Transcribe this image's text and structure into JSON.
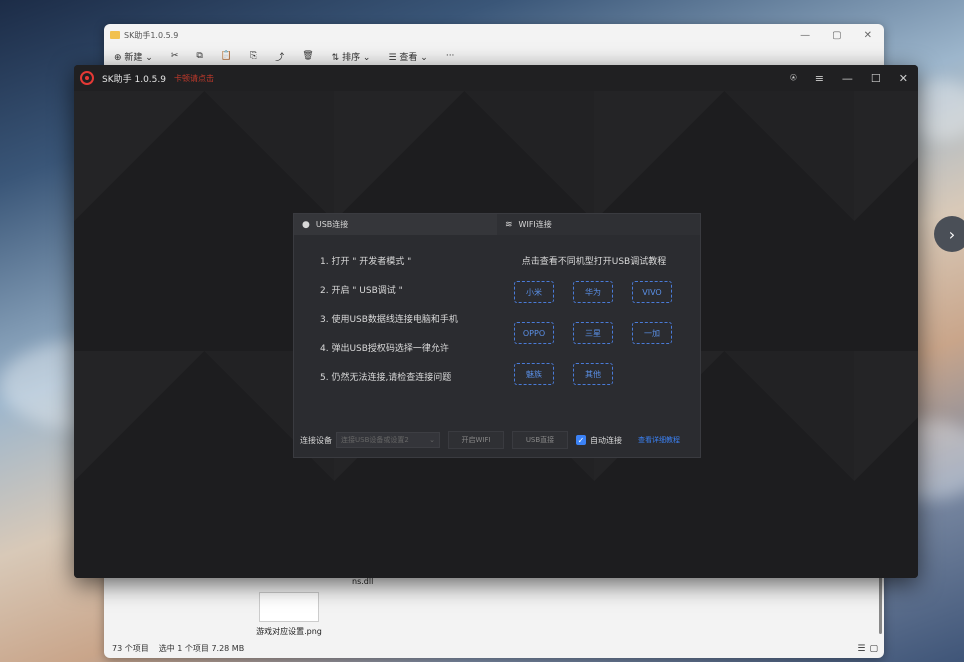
{
  "explorer": {
    "title": "SK助手1.0.5.9",
    "toolbar": [
      "⊕ 新建 ⌄",
      "✂",
      "⧉",
      "📋",
      "⎘",
      "⤴",
      "🗑",
      "⇅ 排序 ⌄",
      "☰ 查看 ⌄",
      "···"
    ],
    "window_controls": [
      "—",
      "▢",
      "✕"
    ],
    "file_dll": "ns.dll",
    "file_png": "游戏对应设置.png",
    "status_items": "73 个项目",
    "status_selected": "选中 1 个项目  7.28 MB"
  },
  "app": {
    "title": "SK助手 1.0.5.9",
    "subtitle": "卡顿请点击",
    "controls": {
      "user": "⍟",
      "menu": "≡",
      "minimize": "—",
      "maximize": "☐",
      "close": "✕"
    }
  },
  "dialog": {
    "tabs": [
      {
        "label": "USB连接",
        "icon": "usb-icon"
      },
      {
        "label": "WIFI连接",
        "icon": "wifi-icon"
      }
    ],
    "steps": [
      "1. 打开 \" 开发者模式 \"",
      "2. 开启 \" USB调试 \"",
      "3. 使用USB数据线连接电脑和手机",
      "4. 弹出USB授权码选择一律允许",
      "5. 仍然无法连接,请检查连接问题"
    ],
    "hint": "点击查看不同机型打开USB调试教程",
    "brands": [
      "小米",
      "华为",
      "VIVO",
      "OPPO",
      "三星",
      "一加",
      "魅族",
      "其他"
    ],
    "bottom": {
      "device_label": "连接设备",
      "select_placeholder": "连接USB设备或设置2",
      "wifi_button": "开启WIFI",
      "usb_button": "USB直接",
      "auto_connect": "自动连接",
      "tutorial_link": "查看详细教程"
    }
  },
  "side_arrow": "›"
}
